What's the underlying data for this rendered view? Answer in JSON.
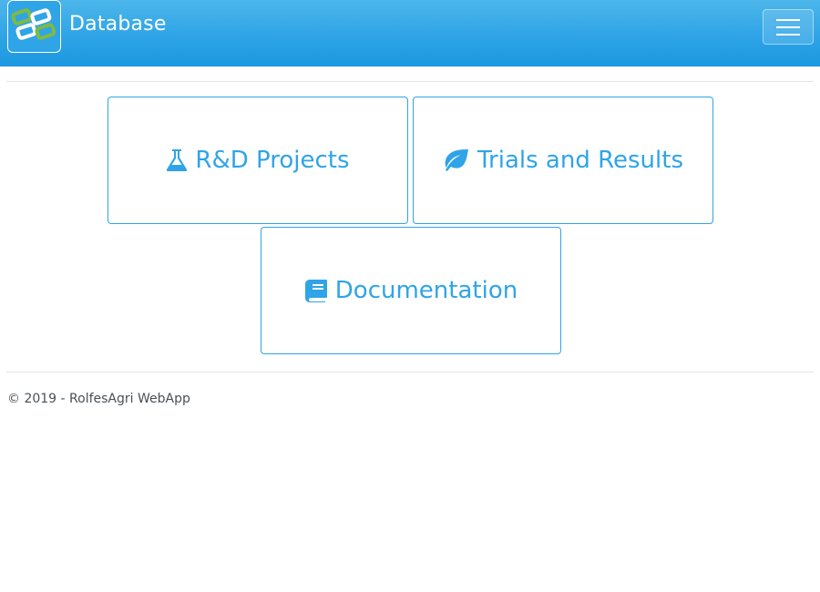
{
  "navbar": {
    "brand_title": "Database",
    "logo_icon": "rolfesagri-logo-icon",
    "toggle_icon": "hamburger-menu-icon",
    "background_color": "#2fa4e7"
  },
  "cards": [
    {
      "label": "R&D Projects",
      "icon": "flask-icon"
    },
    {
      "label": "Trials and Results",
      "icon": "leaf-icon"
    },
    {
      "label": "Documentation",
      "icon": "book-icon"
    }
  ],
  "footer": {
    "text": "© 2019 - RolfesAgri WebApp"
  },
  "colors": {
    "accent": "#2fa4e7",
    "rule": "#e5e5e5",
    "footer_text": "#495057"
  }
}
